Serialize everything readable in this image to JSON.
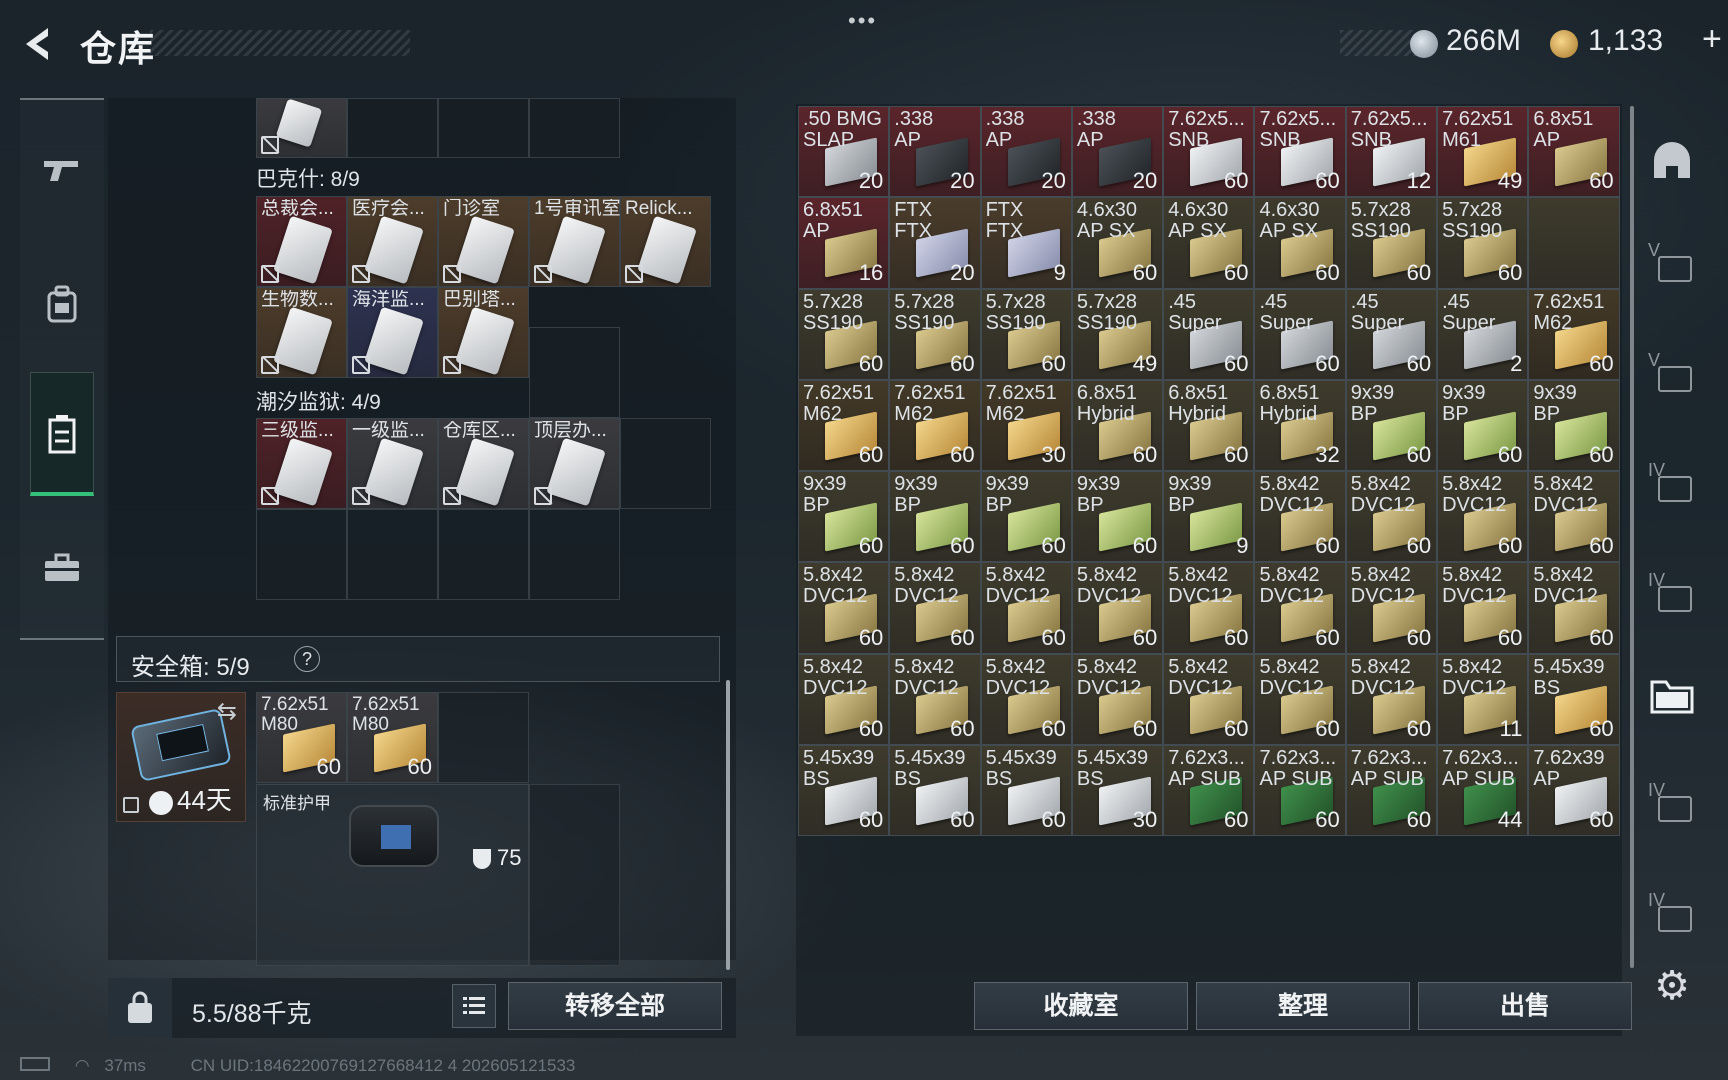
{
  "header": {
    "title": "仓库",
    "dots": "•••",
    "currency_silver": "266M",
    "currency_gold": "1,133",
    "plus": "+"
  },
  "nav": {
    "items": [
      "weapons",
      "backpack",
      "storage",
      "briefcase"
    ],
    "active": "storage"
  },
  "left": {
    "top_partial": {},
    "bakeshi": {
      "title": "巴克什: 8/9",
      "row1": [
        {
          "label": "总裁会...",
          "bg": "red"
        },
        {
          "label": "医疗会...",
          "bg": "gold"
        },
        {
          "label": "门诊室",
          "bg": "gold"
        },
        {
          "label": "1号审讯室",
          "bg": "gold"
        },
        {
          "label": "Relick...",
          "bg": "gold"
        }
      ],
      "row2": [
        {
          "label": "生物数...",
          "bg": "gold"
        },
        {
          "label": "海洋监...",
          "bg": "blue"
        },
        {
          "label": "巴别塔...",
          "bg": "gold"
        }
      ]
    },
    "chaoxi": {
      "title": "潮汐监狱: 4/9",
      "row1": [
        {
          "label": "三级监...",
          "bg": "red"
        },
        {
          "label": "一级监...",
          "bg": "grey"
        },
        {
          "label": "仓库区...",
          "bg": "grey"
        },
        {
          "label": "顶层办...",
          "bg": "grey"
        }
      ]
    },
    "safe": {
      "title": "安全箱:  5/9",
      "help": "?",
      "days": "44天",
      "ammo": [
        {
          "l1": "7.62x51",
          "l2": "M80",
          "count": "60"
        },
        {
          "l1": "7.62x51",
          "l2": "M80",
          "count": "60"
        }
      ],
      "armor": {
        "label": "标准护甲",
        "durability": "75"
      }
    },
    "weight": "5.5/88千克",
    "transfer": "转移全部"
  },
  "grid": [
    [
      {
        "l1": ".50 BMG",
        "l2": "SLAP",
        "c": "20",
        "bg": "red",
        "bx": "silver"
      },
      {
        "l1": ".338",
        "l2": "AP",
        "c": "20",
        "bg": "red",
        "bx": "dark"
      },
      {
        "l1": ".338",
        "l2": "AP",
        "c": "20",
        "bg": "red",
        "bx": "dark"
      },
      {
        "l1": ".338",
        "l2": "AP",
        "c": "20",
        "bg": "red",
        "bx": "dark"
      },
      {
        "l1": "7.62x5...",
        "l2": "SNB",
        "c": "60",
        "bg": "red",
        "bx": "white"
      },
      {
        "l1": "7.62x5...",
        "l2": "SNB",
        "c": "60",
        "bg": "red",
        "bx": "white"
      },
      {
        "l1": "7.62x5...",
        "l2": "SNB",
        "c": "12",
        "bg": "red",
        "bx": "white"
      },
      {
        "l1": "7.62x51",
        "l2": "M61",
        "c": "49",
        "bg": "red",
        "bx": "gold"
      },
      {
        "l1": "6.8x51",
        "l2": "AP",
        "c": "60",
        "bg": "red",
        "bx": "tan"
      }
    ],
    [
      {
        "l1": "6.8x51",
        "l2": "AP",
        "c": "16",
        "bg": "red",
        "bx": "tan"
      },
      {
        "l1": "FTX",
        "l2": "FTX",
        "c": "20",
        "bg": "gold",
        "bx": "lilac"
      },
      {
        "l1": "FTX",
        "l2": "FTX",
        "c": "9",
        "bg": "gold",
        "bx": "lilac"
      },
      {
        "l1": "4.6x30",
        "l2": "AP SX",
        "c": "60",
        "bg": "olive",
        "bx": "tan"
      },
      {
        "l1": "4.6x30",
        "l2": "AP SX",
        "c": "60",
        "bg": "olive",
        "bx": "tan"
      },
      {
        "l1": "4.6x30",
        "l2": "AP SX",
        "c": "60",
        "bg": "olive",
        "bx": "tan"
      },
      {
        "l1": "5.7x28",
        "l2": "SS190",
        "c": "60",
        "bg": "olive",
        "bx": "tan"
      },
      {
        "l1": "5.7x28",
        "l2": "SS190",
        "c": "60",
        "bg": "olive",
        "bx": "tan"
      },
      {
        "l1": "",
        "l2": "",
        "c": "",
        "bg": "olive",
        "bx": ""
      }
    ],
    [
      {
        "l1": "5.7x28",
        "l2": "SS190",
        "c": "60",
        "bg": "olive",
        "bx": "tan"
      },
      {
        "l1": "5.7x28",
        "l2": "SS190",
        "c": "60",
        "bg": "olive",
        "bx": "tan"
      },
      {
        "l1": "5.7x28",
        "l2": "SS190",
        "c": "60",
        "bg": "olive",
        "bx": "tan"
      },
      {
        "l1": "5.7x28",
        "l2": "SS190",
        "c": "49",
        "bg": "olive",
        "bx": "tan"
      },
      {
        "l1": ".45",
        "l2": "Super",
        "c": "60",
        "bg": "olive",
        "bx": "silver"
      },
      {
        "l1": ".45",
        "l2": "Super",
        "c": "60",
        "bg": "olive",
        "bx": "silver"
      },
      {
        "l1": ".45",
        "l2": "Super",
        "c": "60",
        "bg": "olive",
        "bx": "silver"
      },
      {
        "l1": ".45",
        "l2": "Super",
        "c": "2",
        "bg": "olive",
        "bx": "silver"
      },
      {
        "l1": "7.62x51",
        "l2": "M62",
        "c": "60",
        "bg": "dkgold",
        "bx": "gold"
      }
    ],
    [
      {
        "l1": "7.62x51",
        "l2": "M62",
        "c": "60",
        "bg": "dkgold",
        "bx": "gold"
      },
      {
        "l1": "7.62x51",
        "l2": "M62",
        "c": "60",
        "bg": "dkgold",
        "bx": "gold"
      },
      {
        "l1": "7.62x51",
        "l2": "M62",
        "c": "30",
        "bg": "dkgold",
        "bx": "gold"
      },
      {
        "l1": "6.8x51",
        "l2": "Hybrid",
        "c": "60",
        "bg": "olive",
        "bx": "tan"
      },
      {
        "l1": "6.8x51",
        "l2": "Hybrid",
        "c": "60",
        "bg": "olive",
        "bx": "tan"
      },
      {
        "l1": "6.8x51",
        "l2": "Hybrid",
        "c": "32",
        "bg": "olive",
        "bx": "tan"
      },
      {
        "l1": "9x39",
        "l2": "BP",
        "c": "60",
        "bg": "olive",
        "bx": "green"
      },
      {
        "l1": "9x39",
        "l2": "BP",
        "c": "60",
        "bg": "olive",
        "bx": "green"
      },
      {
        "l1": "9x39",
        "l2": "BP",
        "c": "60",
        "bg": "olive",
        "bx": "green"
      }
    ],
    [
      {
        "l1": "9x39",
        "l2": "BP",
        "c": "60",
        "bg": "olive",
        "bx": "green"
      },
      {
        "l1": "9x39",
        "l2": "BP",
        "c": "60",
        "bg": "olive",
        "bx": "green"
      },
      {
        "l1": "9x39",
        "l2": "BP",
        "c": "60",
        "bg": "olive",
        "bx": "green"
      },
      {
        "l1": "9x39",
        "l2": "BP",
        "c": "60",
        "bg": "olive",
        "bx": "green"
      },
      {
        "l1": "9x39",
        "l2": "BP",
        "c": "9",
        "bg": "olive",
        "bx": "green"
      },
      {
        "l1": "5.8x42",
        "l2": "DVC12",
        "c": "60",
        "bg": "olive",
        "bx": "tan"
      },
      {
        "l1": "5.8x42",
        "l2": "DVC12",
        "c": "60",
        "bg": "olive",
        "bx": "tan"
      },
      {
        "l1": "5.8x42",
        "l2": "DVC12",
        "c": "60",
        "bg": "olive",
        "bx": "tan"
      },
      {
        "l1": "5.8x42",
        "l2": "DVC12",
        "c": "60",
        "bg": "olive",
        "bx": "tan"
      }
    ],
    [
      {
        "l1": "5.8x42",
        "l2": "DVC12",
        "c": "60",
        "bg": "olive",
        "bx": "tan"
      },
      {
        "l1": "5.8x42",
        "l2": "DVC12",
        "c": "60",
        "bg": "olive",
        "bx": "tan"
      },
      {
        "l1": "5.8x42",
        "l2": "DVC12",
        "c": "60",
        "bg": "olive",
        "bx": "tan"
      },
      {
        "l1": "5.8x42",
        "l2": "DVC12",
        "c": "60",
        "bg": "olive",
        "bx": "tan"
      },
      {
        "l1": "5.8x42",
        "l2": "DVC12",
        "c": "60",
        "bg": "olive",
        "bx": "tan"
      },
      {
        "l1": "5.8x42",
        "l2": "DVC12",
        "c": "60",
        "bg": "olive",
        "bx": "tan"
      },
      {
        "l1": "5.8x42",
        "l2": "DVC12",
        "c": "60",
        "bg": "olive",
        "bx": "tan"
      },
      {
        "l1": "5.8x42",
        "l2": "DVC12",
        "c": "60",
        "bg": "olive",
        "bx": "tan"
      },
      {
        "l1": "5.8x42",
        "l2": "DVC12",
        "c": "60",
        "bg": "olive",
        "bx": "tan"
      }
    ],
    [
      {
        "l1": "5.8x42",
        "l2": "DVC12",
        "c": "60",
        "bg": "olive",
        "bx": "tan"
      },
      {
        "l1": "5.8x42",
        "l2": "DVC12",
        "c": "60",
        "bg": "olive",
        "bx": "tan"
      },
      {
        "l1": "5.8x42",
        "l2": "DVC12",
        "c": "60",
        "bg": "olive",
        "bx": "tan"
      },
      {
        "l1": "5.8x42",
        "l2": "DVC12",
        "c": "60",
        "bg": "olive",
        "bx": "tan"
      },
      {
        "l1": "5.8x42",
        "l2": "DVC12",
        "c": "60",
        "bg": "olive",
        "bx": "tan"
      },
      {
        "l1": "5.8x42",
        "l2": "DVC12",
        "c": "60",
        "bg": "olive",
        "bx": "tan"
      },
      {
        "l1": "5.8x42",
        "l2": "DVC12",
        "c": "60",
        "bg": "olive",
        "bx": "tan"
      },
      {
        "l1": "5.8x42",
        "l2": "DVC12",
        "c": "11",
        "bg": "olive",
        "bx": "tan"
      },
      {
        "l1": "5.45x39",
        "l2": "BS",
        "c": "60",
        "bg": "olive",
        "bx": "gold"
      }
    ],
    [
      {
        "l1": "5.45x39",
        "l2": "BS",
        "c": "60",
        "bg": "olive",
        "bx": "white"
      },
      {
        "l1": "5.45x39",
        "l2": "BS",
        "c": "60",
        "bg": "olive",
        "bx": "white"
      },
      {
        "l1": "5.45x39",
        "l2": "BS",
        "c": "60",
        "bg": "olive",
        "bx": "white"
      },
      {
        "l1": "5.45x39",
        "l2": "BS",
        "c": "30",
        "bg": "olive",
        "bx": "white"
      },
      {
        "l1": "7.62x3...",
        "l2": "AP SUB",
        "c": "60",
        "bg": "olive",
        "bx": "mag"
      },
      {
        "l1": "7.62x3...",
        "l2": "AP SUB",
        "c": "60",
        "bg": "olive",
        "bx": "mag"
      },
      {
        "l1": "7.62x3...",
        "l2": "AP SUB",
        "c": "60",
        "bg": "olive",
        "bx": "mag"
      },
      {
        "l1": "7.62x3...",
        "l2": "AP SUB",
        "c": "44",
        "bg": "olive",
        "bx": "mag"
      },
      {
        "l1": "7.62x39",
        "l2": "AP",
        "c": "60",
        "bg": "olive",
        "bx": "white"
      }
    ]
  ],
  "right_tabs": [
    "V",
    "V",
    "IV",
    "IV",
    "IV",
    "IV",
    "IV"
  ],
  "buttons": {
    "collection": "收藏室",
    "sort": "整理",
    "sell": "出售"
  },
  "status": {
    "ping": "37ms",
    "uid": "CN UID:18462200769127668412 4 202605121533"
  }
}
